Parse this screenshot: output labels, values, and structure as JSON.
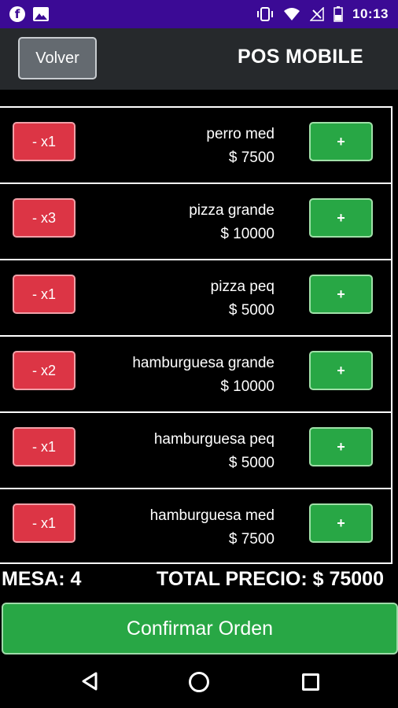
{
  "status_bar": {
    "time": "10:13",
    "icons": [
      "facebook-icon",
      "gallery-icon",
      "vibrate-icon",
      "wifi-icon",
      "signal-icon",
      "battery-icon"
    ]
  },
  "header": {
    "back_label": "Volver",
    "title": "POS MOBILE"
  },
  "items": [
    {
      "minus_label": "- x1",
      "name": "perro med",
      "price": "$ 7500",
      "plus_label": "+"
    },
    {
      "minus_label": "- x3",
      "name": "pizza grande",
      "price": "$ 10000",
      "plus_label": "+"
    },
    {
      "minus_label": "- x1",
      "name": "pizza peq",
      "price": "$ 5000",
      "plus_label": "+"
    },
    {
      "minus_label": "- x2",
      "name": "hamburguesa grande",
      "price": "$ 10000",
      "plus_label": "+"
    },
    {
      "minus_label": "- x1",
      "name": "hamburguesa peq",
      "price": "$ 5000",
      "plus_label": "+"
    },
    {
      "minus_label": "- x1",
      "name": "hamburguesa med",
      "price": "$ 7500",
      "plus_label": "+"
    }
  ],
  "summary": {
    "mesa": "MESA: 4",
    "total": "TOTAL PRECIO: $ 75000"
  },
  "confirm_label": "Confirmar Orden",
  "colors": {
    "status_bar": "#3b0a95",
    "app_bar": "#26292c",
    "danger": "#dc3545",
    "success": "#28a745",
    "background": "#000000"
  },
  "nav_bar": {
    "icons": [
      "back-triangle-icon",
      "home-circle-icon",
      "recents-square-icon"
    ]
  }
}
